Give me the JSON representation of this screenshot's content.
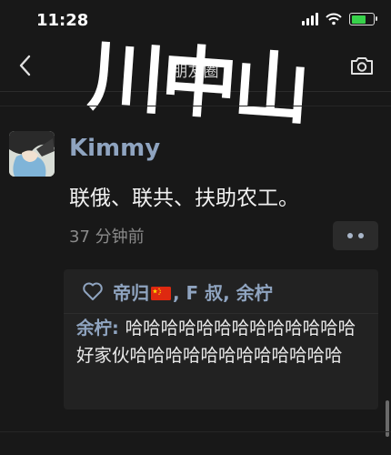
{
  "status_bar": {
    "time": "11:28",
    "battery_color": "#37d24a",
    "battery_level": 0.7,
    "icons": [
      "signal-icon",
      "wifi-icon",
      "battery-charging-icon"
    ]
  },
  "nav": {
    "title": "朋友圈",
    "back_icon": "chevron-left-icon",
    "camera_icon": "camera-icon"
  },
  "overlay": {
    "text": "川中山"
  },
  "post": {
    "author": "Kimmy",
    "text": "联俄、联共、扶助农工。",
    "time_ago": "37 分钟前",
    "more_icon": "more-dots-icon"
  },
  "interactions": {
    "like_icon": "heart-outline-icon",
    "likers_prefix": "帝归",
    "flag_icon": "china-flag-icon",
    "likers_rest": ", F 叔, 余柠",
    "comment_author": "余柠",
    "comment_separator": ": ",
    "comment_text": "哈哈哈哈哈哈哈哈哈哈哈哈哈好家伙哈哈哈哈哈哈哈哈哈哈哈哈"
  },
  "colors": {
    "background": "#181818",
    "name_blue": "#8fa4c0",
    "panel": "#222222"
  }
}
